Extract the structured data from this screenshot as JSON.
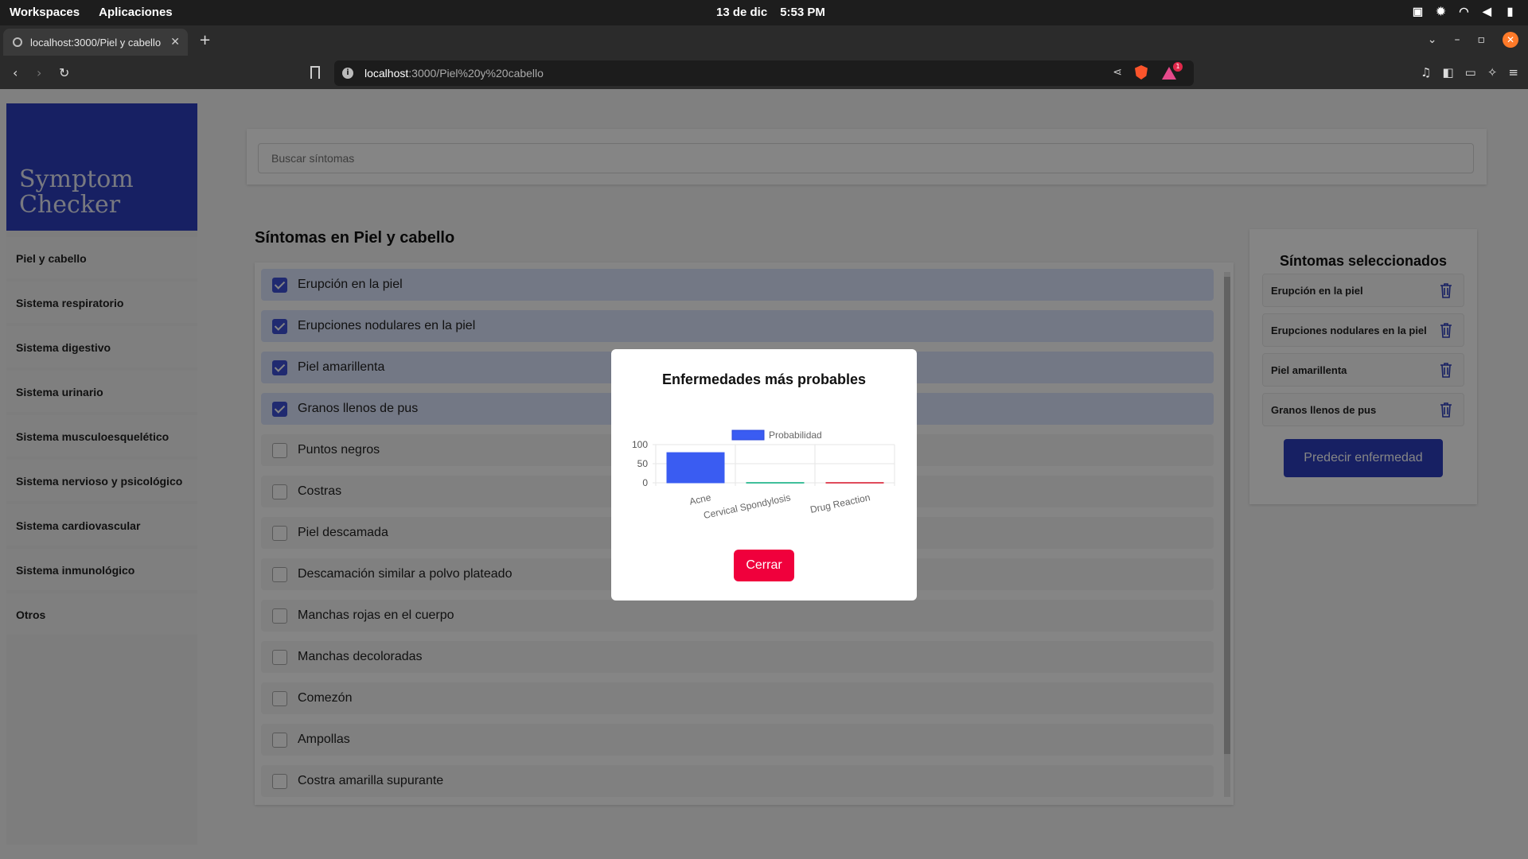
{
  "os": {
    "workspaces": "Workspaces",
    "apps": "Aplicaciones",
    "date": "13 de dic",
    "time": "5:53 PM"
  },
  "browser": {
    "tab_title": "localhost:3000/Piel y cabello",
    "url_host": "localhost",
    "url_rest": ":3000/Piel%20y%20cabello",
    "badge_count": "1"
  },
  "app": {
    "logo_line1": "Symptom",
    "logo_line2": "Checker",
    "nav": [
      "Piel y cabello",
      "Sistema respiratorio",
      "Sistema digestivo",
      "Sistema urinario",
      "Sistema musculoesquelético",
      "Sistema nervioso y psicológico",
      "Sistema cardiovascular",
      "Sistema inmunológico",
      "Otros"
    ],
    "search_placeholder": "Buscar síntomas",
    "section_title": "Síntomas en Piel y cabello",
    "symptoms": [
      {
        "label": "Erupción en la piel",
        "checked": true
      },
      {
        "label": "Erupciones nodulares en la piel",
        "checked": true
      },
      {
        "label": "Piel amarillenta",
        "checked": true
      },
      {
        "label": "Granos llenos de pus",
        "checked": true
      },
      {
        "label": "Puntos negros",
        "checked": false
      },
      {
        "label": "Costras",
        "checked": false
      },
      {
        "label": "Piel descamada",
        "checked": false
      },
      {
        "label": "Descamación similar a polvo plateado",
        "checked": false
      },
      {
        "label": "Manchas rojas en el cuerpo",
        "checked": false
      },
      {
        "label": "Manchas decoloradas",
        "checked": false
      },
      {
        "label": "Comezón",
        "checked": false
      },
      {
        "label": "Ampollas",
        "checked": false
      },
      {
        "label": "Costra amarilla supurante",
        "checked": false
      }
    ],
    "selected_title": "Síntomas seleccionados",
    "selected": [
      "Erupción en la piel",
      "Erupciones nodulares en la piel",
      "Piel amarillenta",
      "Granos llenos de pus"
    ],
    "predict_label": "Predecir enfermedad"
  },
  "modal": {
    "title": "Enfermedades más probables",
    "close_label": "Cerrar"
  },
  "chart_data": {
    "type": "bar",
    "categories": [
      "Acne",
      "Cervical Spondylosis",
      "Drug Reaction"
    ],
    "series": [
      {
        "name": "Probabilidad",
        "values": [
          79,
          1,
          1
        ]
      }
    ],
    "colors": [
      "#3a5cf2",
      "#3fbf9a",
      "#e04a5a"
    ],
    "ylim": [
      0,
      100
    ],
    "yticks": [
      0,
      50,
      100
    ],
    "xlabel": "",
    "ylabel": "",
    "grid": true,
    "legend": "top"
  }
}
